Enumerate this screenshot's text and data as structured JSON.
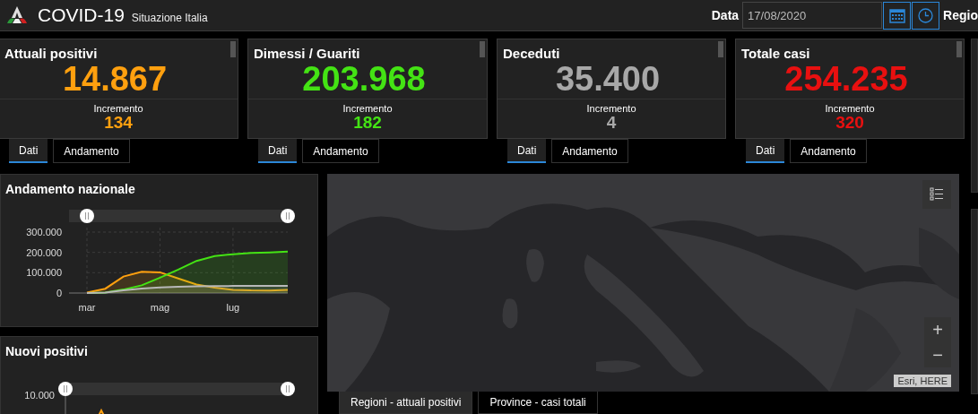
{
  "header": {
    "title": "COVID-19",
    "subtitle": "Situazione Italia",
    "date_label": "Data",
    "date_value": "17/08/2020",
    "region_label": "Regio"
  },
  "cards": [
    {
      "title": "Attuali positivi",
      "value": "14.867",
      "increment_label": "Incremento",
      "increment": "134",
      "color": "#ffa00f",
      "tabs": [
        {
          "label": "Dati",
          "selected": true
        },
        {
          "label": "Andamento",
          "selected": false
        }
      ]
    },
    {
      "title": "Dimessi / Guariti",
      "value": "203.968",
      "increment_label": "Incremento",
      "increment": "182",
      "color": "#44e314",
      "tabs": [
        {
          "label": "Dati",
          "selected": true
        },
        {
          "label": "Andamento",
          "selected": false
        }
      ]
    },
    {
      "title": "Deceduti",
      "value": "35.400",
      "increment_label": "Incremento",
      "increment": "4",
      "color": "#a8a8a8",
      "tabs": [
        {
          "label": "Dati",
          "selected": true
        },
        {
          "label": "Andamento",
          "selected": false
        }
      ]
    },
    {
      "title": "Totale casi",
      "value": "254.235",
      "increment_label": "Incremento",
      "increment": "320",
      "color": "#e81010",
      "tabs": [
        {
          "label": "Dati",
          "selected": true
        },
        {
          "label": "Andamento",
          "selected": false
        }
      ]
    }
  ],
  "national_trend": {
    "title": "Andamento nazionale",
    "chart_data": {
      "type": "area",
      "grid": true,
      "categories": [
        "mar",
        null,
        null,
        null,
        "mag",
        null,
        null,
        null,
        "lug",
        null,
        null,
        null
      ],
      "ylim": [
        0,
        300000
      ],
      "yticks": [
        {
          "value": 0,
          "label": "0"
        },
        {
          "value": 100000,
          "label": "100.000"
        },
        {
          "value": 200000,
          "label": "200.000"
        },
        {
          "value": 300000,
          "label": "300.000"
        }
      ],
      "series": [
        {
          "color": "#ffa00f",
          "values": [
            2000,
            21000,
            81000,
            105000,
            102000,
            72000,
            42000,
            26000,
            16000,
            13000,
            12000,
            15000
          ]
        },
        {
          "color": "#44e314",
          "values": [
            0,
            2000,
            17000,
            38000,
            76000,
            115000,
            158000,
            182000,
            191000,
            197000,
            200000,
            204000
          ]
        },
        {
          "color": "#b8b8b8",
          "values": [
            0,
            2000,
            13000,
            22000,
            28000,
            31000,
            33000,
            34000,
            35000,
            35000,
            35000,
            35000
          ]
        }
      ]
    }
  },
  "new_positives": {
    "title": "Nuovi positivi",
    "ytick_label": "10.000"
  },
  "map": {
    "zoom_in": "+",
    "zoom_out": "−",
    "attribution": "Esri, HERE",
    "tabs": [
      {
        "label": "Regioni - attuali positivi",
        "selected": true
      },
      {
        "label": "Province - casi totali",
        "selected": false
      }
    ]
  }
}
